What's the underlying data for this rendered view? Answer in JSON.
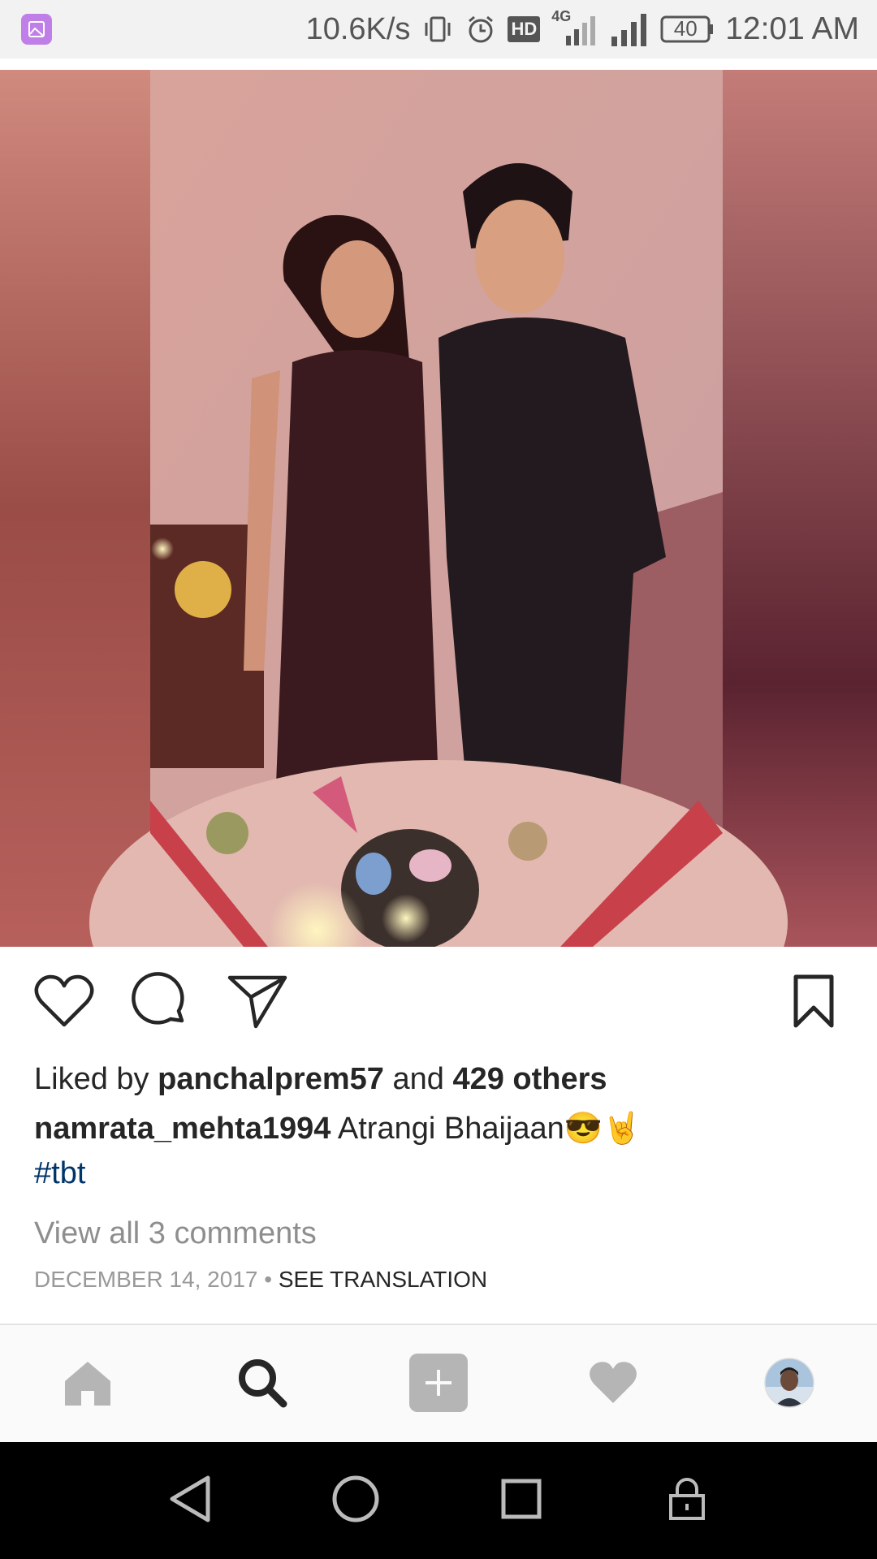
{
  "status_bar": {
    "network_speed": "10.6K/s",
    "hd_label": "HD",
    "network_type": "4G",
    "battery_level": "40",
    "time": "12:01 AM",
    "icons": [
      "gallery-app-icon",
      "vibrate-icon",
      "alarm-icon",
      "hd-icon",
      "4g-signal-icon",
      "signal-icon",
      "battery-icon"
    ]
  },
  "post": {
    "image_alt": "photo",
    "actions": {
      "like_icon": "heart-outline-icon",
      "comment_icon": "comment-bubble-icon",
      "share_icon": "paper-plane-icon",
      "save_icon": "bookmark-icon"
    },
    "likes": {
      "prefix": "Liked by",
      "user": "panchalprem57",
      "connector": "and",
      "others": "429 others"
    },
    "caption": {
      "username": "namrata_mehta1994",
      "text": "Atrangi Bhaijaan😎🤘",
      "hashtag": "#tbt"
    },
    "view_comments": "View all 3 comments",
    "date": "DECEMBER 14, 2017",
    "separator": "•",
    "see_translation": "SEE TRANSLATION"
  },
  "bottom_nav": {
    "items": [
      "home-icon",
      "search-icon",
      "add-post-icon",
      "activity-heart-icon",
      "profile-avatar"
    ],
    "active": "search-icon"
  },
  "system_nav": {
    "items": [
      "back-icon",
      "home-circle-icon",
      "recents-icon",
      "lock-icon"
    ]
  },
  "colors": {
    "text": "#262626",
    "hashtag": "#003569",
    "muted": "#8e8e8e",
    "nav_inactive": "#b5b5b5"
  }
}
